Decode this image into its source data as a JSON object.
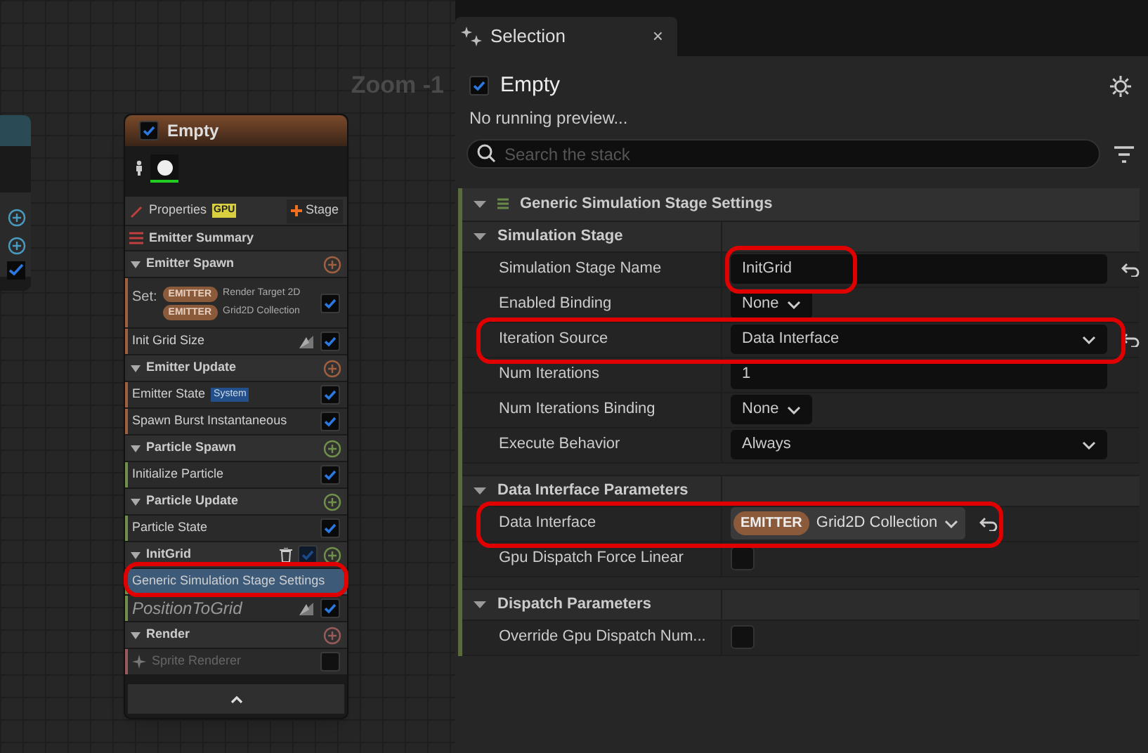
{
  "canvas": {
    "zoom_label": "Zoom -1"
  },
  "node": {
    "title": "Empty",
    "enabled": true,
    "properties": {
      "label": "Properties",
      "badge": "GPU",
      "stage_button": "Stage"
    },
    "summary": "Emitter Summary",
    "groups": [
      {
        "title": "Emitter Spawn",
        "color": "#a0603f",
        "items": [
          {
            "kind": "set",
            "prefix": "Set:",
            "chips": [
              {
                "tag": "EMITTER",
                "label": "Render Target 2D"
              },
              {
                "tag": "EMITTER",
                "label": "Grid2D Collection"
              }
            ],
            "checked": true,
            "selected": false
          },
          {
            "kind": "module",
            "label": "Init Grid Size",
            "checked": true,
            "selected": false,
            "scratch": true
          }
        ]
      },
      {
        "title": "Emitter Update",
        "color": "#a0603f",
        "items": [
          {
            "kind": "module",
            "label": "Emitter State",
            "badge": "System",
            "checked": true,
            "selected": false
          },
          {
            "kind": "module",
            "label": "Spawn Burst Instantaneous",
            "checked": true,
            "selected": false
          }
        ]
      },
      {
        "title": "Particle Spawn",
        "color": "#6f8f4a",
        "items": [
          {
            "kind": "module",
            "label": "Initialize Particle",
            "checked": true,
            "selected": false
          }
        ]
      },
      {
        "title": "Particle Update",
        "color": "#6f8f4a",
        "items": [
          {
            "kind": "module",
            "label": "Particle State",
            "checked": true,
            "selected": false
          }
        ]
      },
      {
        "title": "InitGrid",
        "color": "#6f8f4a",
        "delete": true,
        "checked": true,
        "items": [
          {
            "kind": "setting",
            "label": "Generic Simulation Stage Settings",
            "selected": true,
            "highlighted": true
          },
          {
            "kind": "script",
            "label": "PositionToGrid",
            "checked": true,
            "selected": false,
            "scratch": true
          }
        ]
      },
      {
        "title": "Render",
        "color": "#9a5a5a",
        "items": [
          {
            "kind": "renderer",
            "label": "Sprite Renderer",
            "checked": false,
            "selected": false,
            "disabled": true
          }
        ]
      }
    ]
  },
  "panel": {
    "tab": {
      "label": "Selection",
      "close": "×"
    },
    "emitter": {
      "name": "Empty",
      "checked": true
    },
    "status": "No running preview...",
    "search": {
      "placeholder": "Search the stack"
    },
    "section": "Generic Simulation Stage Settings",
    "categories": [
      {
        "title": "Simulation Stage",
        "rows": [
          {
            "label": "Simulation Stage Name",
            "kind": "text",
            "value": "InitGrid",
            "reset": true,
            "highlighted": true
          },
          {
            "label": "Enabled Binding",
            "kind": "small-dropdown",
            "value": "None"
          },
          {
            "label": "Iteration Source",
            "kind": "dropdown",
            "value": "Data Interface",
            "reset": true,
            "highlighted": true
          },
          {
            "label": "Num Iterations",
            "kind": "text",
            "value": "1"
          },
          {
            "label": "Num Iterations Binding",
            "kind": "small-dropdown",
            "value": "None"
          },
          {
            "label": "Execute Behavior",
            "kind": "dropdown",
            "value": "Always"
          }
        ]
      },
      {
        "title": "Data Interface Parameters",
        "rows": [
          {
            "label": "Data Interface",
            "kind": "chip-dropdown",
            "tag": "EMITTER",
            "value": "Grid2D Collection",
            "reset": true,
            "highlighted": true
          },
          {
            "label": "Gpu Dispatch Force Linear",
            "kind": "checkbox",
            "checked": false
          }
        ]
      },
      {
        "title": "Dispatch Parameters",
        "rows": [
          {
            "label": "Override Gpu Dispatch Num...",
            "kind": "checkbox",
            "checked": false
          }
        ]
      }
    ]
  }
}
